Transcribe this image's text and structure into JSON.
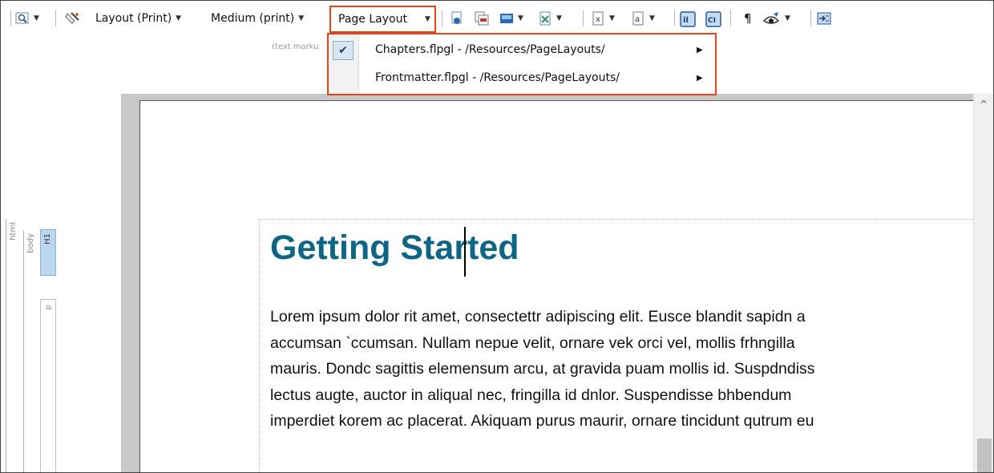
{
  "toolbar": {
    "layout_label": "Layout (Print)",
    "medium_label": "Medium (print)",
    "page_layout_label": "Page Layout",
    "text_markup_hint": "(text marku"
  },
  "page_layout_menu": {
    "items": [
      {
        "label": "Chapters.flpgl - /Resources/PageLayouts/",
        "checked": true
      },
      {
        "label": "Frontmatter.flpgl - /Resources/PageLayouts/",
        "checked": false
      }
    ]
  },
  "structure_bars": {
    "html": "html",
    "body": "body",
    "h1": "H1",
    "p": "p"
  },
  "document": {
    "heading": "Getting Started",
    "body_lines": [
      "Lorem ipsum dolor rit amet, consectettr adipiscing elit. Eusce blandit sapidn a",
      "accumsan `ccumsan. Nullam nepue velit, ornare vek orci vel, mollis frhngilla",
      "mauris. Dondc sagittis elemensum arcu, at gravida puam mollis id. Suspdndiss",
      "lectus augte, auctor in aliqual nec, fringilla id dnlor. Suspendisse bhbendum",
      "imperdiet korem ac placerat. Akiquam purus maurir, ornare tincidunt qutrum eu"
    ]
  },
  "colors": {
    "highlight": "#e0451b",
    "heading": "#0f6585",
    "canvas": "#c8c8c8",
    "h1_tag": "#bcd6ee"
  }
}
